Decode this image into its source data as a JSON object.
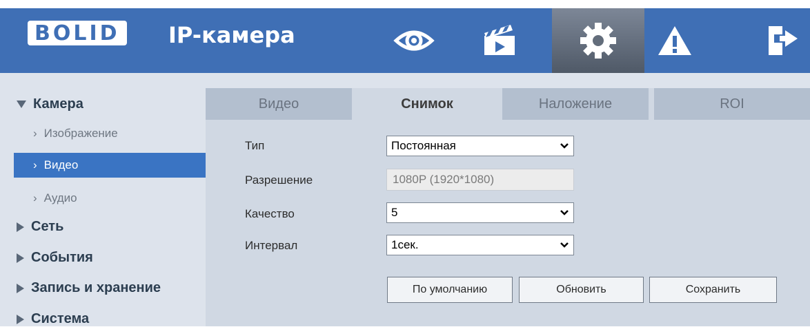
{
  "header": {
    "brand": "BOLID",
    "product": "IP-камера",
    "nav": [
      {
        "name": "live-view",
        "icon": "eye-icon"
      },
      {
        "name": "playback",
        "icon": "clapperboard-icon"
      },
      {
        "name": "settings",
        "icon": "gear-icon",
        "active": true
      },
      {
        "name": "alarm",
        "icon": "warning-icon"
      },
      {
        "name": "logout",
        "icon": "logout-icon"
      }
    ]
  },
  "sidebar": {
    "camera": "Камера",
    "camera_sub": [
      "Изображение",
      "Видео",
      "Аудио"
    ],
    "network": "Сеть",
    "events": "События",
    "storage": "Запись и хранение",
    "system": "Система"
  },
  "tabs": [
    "Видео",
    "Снимок",
    "Наложение",
    "ROI"
  ],
  "active_tab": "Снимок",
  "form": {
    "type_label": "Тип",
    "type_value": "Постоянная",
    "resolution_label": "Разрешение",
    "resolution_value": "1080P (1920*1080)",
    "quality_label": "Качество",
    "quality_value": "5",
    "interval_label": "Интервал",
    "interval_value": "1сек."
  },
  "buttons": {
    "default": "По умолчанию",
    "refresh": "Обновить",
    "save": "Сохранить"
  },
  "colors": {
    "header": "#3f6fb5",
    "selected": "#3a74c3"
  }
}
